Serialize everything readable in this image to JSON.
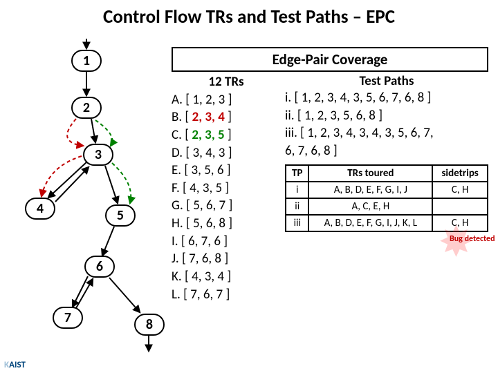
{
  "title": "Control Flow TRs and Test Paths – EPC",
  "epc_title": "Edge-Pair Coverage",
  "nodes": [
    "1",
    "2",
    "3",
    "4",
    "5",
    "6",
    "7",
    "8"
  ],
  "trs": {
    "header": "12 TRs",
    "items": [
      "A. [ 1, 2, 3 ]",
      "B. [ 2, 3, 4 ]",
      "C. [ 2, 3, 5 ]",
      "D. [ 3, 4, 3 ]",
      "E. [ 3, 5, 6 ]",
      "F. [ 4, 3, 5 ]",
      "G. [ 5, 6, 7 ]",
      "H. [ 5, 6, 8 ]",
      "I. [ 6, 7, 6 ]",
      "J. [ 7, 6, 8 ]",
      "K. [ 4, 3, 4 ]",
      "L. [ 7, 6, 7 ]"
    ]
  },
  "test_paths": {
    "header": "Test Paths",
    "items": [
      "i. [ 1, 2, 3, 4, 3, 5, 6, 7, 6, 8 ]",
      "ii. [ 1, 2, 3, 5, 6, 8 ]",
      "iii. [ 1, 2, 3, 4, 3, 4, 3, 5, 6, 7,",
      "       6, 7, 6, 8 ]"
    ]
  },
  "table": {
    "headers": [
      "TP",
      "TRs toured",
      "sidetrips"
    ],
    "rows": [
      {
        "tp": "i",
        "toured": "A, B, D, E, F, G, I, J",
        "sidetrips": "C, H"
      },
      {
        "tp": "ii",
        "toured": "A, C, E, H",
        "sidetrips": ""
      },
      {
        "tp": "iii",
        "toured": "A, B, D, E, F, G, I, J, K, L",
        "sidetrips": "C, H"
      }
    ]
  },
  "bug_label": "Bug detected",
  "logo": "KAIST"
}
